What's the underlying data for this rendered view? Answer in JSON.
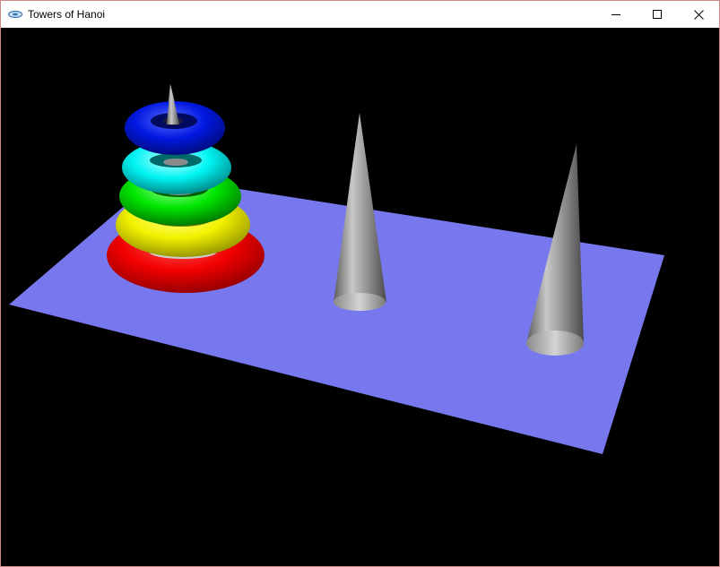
{
  "window": {
    "title": "Towers of Hanoi",
    "icon": "app-icon",
    "controls": [
      "minimize-icon",
      "maximize-icon",
      "close-icon"
    ]
  },
  "scene": {
    "background": "#000000",
    "board_color": "#7878ee",
    "peg_color": "#a0a0a0",
    "pegs": 3,
    "disks": [
      {
        "color": "blue",
        "hex": "#0018e0",
        "peg": 1,
        "level": 5
      },
      {
        "color": "cyan",
        "hex": "#00f4f4",
        "peg": 1,
        "level": 4
      },
      {
        "color": "green",
        "hex": "#00e600",
        "peg": 1,
        "level": 3
      },
      {
        "color": "yellow",
        "hex": "#f2f200",
        "peg": 1,
        "level": 2
      },
      {
        "color": "red",
        "hex": "#f20000",
        "peg": 1,
        "level": 1
      }
    ]
  }
}
